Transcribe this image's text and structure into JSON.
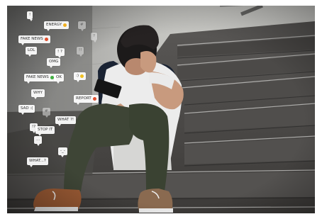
{
  "photo": {
    "subject": "boy-sitting-on-stairs-with-phone",
    "colors": {
      "wall": "#c8c8c4",
      "stairs": "#4a4846",
      "stair_edge": "#2a2a2a",
      "shirt": "#eeeeee",
      "pants": "#3e4536",
      "hair": "#1c1a1a",
      "skin": "#c89a7e",
      "backpack": "#1a2333",
      "shoes": "#9a5a34"
    }
  },
  "bubbles": [
    {
      "text": "!",
      "tone": "solid",
      "dot": null
    },
    {
      "text": "ENERGY",
      "tone": "solid",
      "dot": "#f0b020"
    },
    {
      "text": "FAKE NEWS",
      "tone": "solid",
      "dot": "#e05030"
    },
    {
      "text": "#",
      "tone": "faded",
      "dot": null
    },
    {
      "text": "LOL",
      "tone": "solid",
      "dot": null
    },
    {
      "text": "?",
      "tone": "faded",
      "dot": null
    },
    {
      "text": "! ?",
      "tone": "solid",
      "dot": null
    },
    {
      "text": "!!",
      "tone": "faded",
      "dot": null
    },
    {
      "text": "OMG",
      "tone": "solid",
      "dot": null
    },
    {
      "text": "FAKE NEWS",
      "tone": "solid",
      "dot": "#40b040"
    },
    {
      "text": "OK",
      "tone": "solid",
      "dot": null
    },
    {
      "text": ":)",
      "tone": "solid",
      "dot": "#f0c020"
    },
    {
      "text": "WHY",
      "tone": "solid",
      "dot": null
    },
    {
      "text": "REPORT",
      "tone": "solid",
      "dot": "#e05030"
    },
    {
      "text": "SAD :(",
      "tone": "solid",
      "dot": null
    },
    {
      "text": "#",
      "tone": "faded",
      "dot": null
    },
    {
      "text": "WHAT ?!",
      "tone": "solid",
      "dot": null
    },
    {
      "text": "!?",
      "tone": "solid",
      "dot": null
    },
    {
      "text": "STOP IT",
      "tone": "solid",
      "dot": null
    },
    {
      "text": "...",
      "tone": "solid",
      "dot": null
    },
    {
      "text": "-_-",
      "tone": "solid",
      "dot": null
    },
    {
      "text": "WHAT...?",
      "tone": "solid",
      "dot": null
    }
  ]
}
